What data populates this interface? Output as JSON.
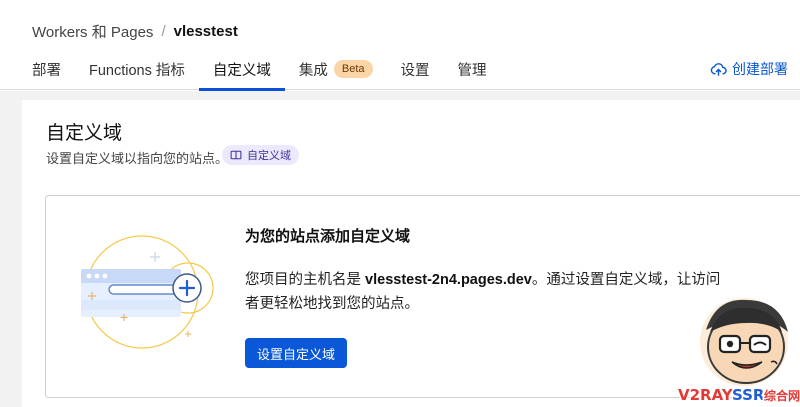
{
  "breadcrumb": {
    "parent": "Workers 和 Pages",
    "separator": "/",
    "current": "vlesstest"
  },
  "tabs": [
    {
      "label": "部署",
      "active": false
    },
    {
      "label": "Functions 指标",
      "active": false
    },
    {
      "label": "自定义域",
      "active": true
    },
    {
      "label": "集成",
      "badge": "Beta",
      "active": false
    },
    {
      "label": "设置",
      "active": false
    },
    {
      "label": "管理",
      "active": false
    }
  ],
  "header_action": {
    "label": "创建部署",
    "icon": "cloud-upload-icon"
  },
  "section": {
    "title": "自定义域",
    "description": "设置自定义域以指向您的站点。",
    "doc_chip": "自定义域"
  },
  "card": {
    "title": "为您的站点添加自定义域",
    "body_prefix": "您项目的主机名是 ",
    "hostname": "vlesstest-2n4.pages.dev",
    "body_suffix": "。通过设置自定义域，让访问者更轻松地找到您的站点。",
    "button": "设置自定义域"
  },
  "watermark": "V2RAYSSR综合网",
  "colors": {
    "accent": "#0a58d8",
    "tab_underline": "#0a4fd8",
    "badge_bg": "#fbd5a6",
    "chip_bg": "#ece9ff",
    "illustration_ring": "#f2c94c"
  }
}
